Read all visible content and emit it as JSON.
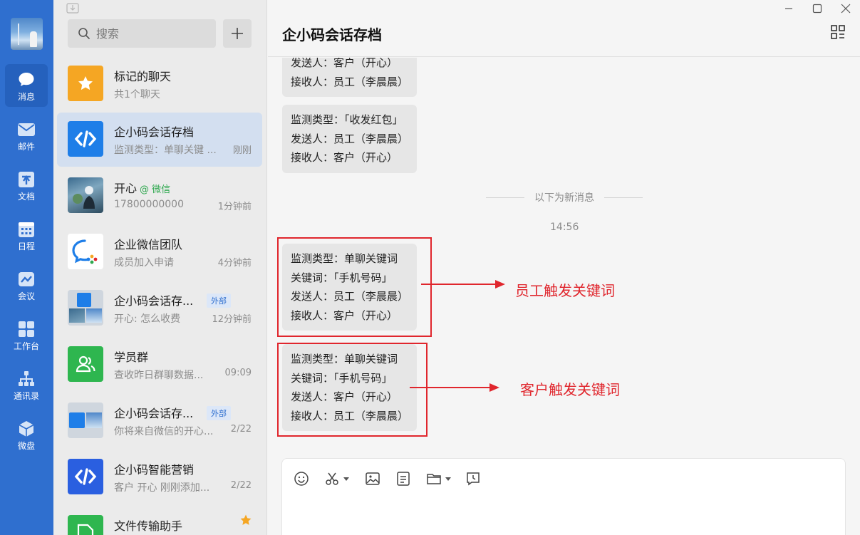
{
  "nav": {
    "items": [
      {
        "label": "消息",
        "icon": "chat-bubble-icon"
      },
      {
        "label": "邮件",
        "icon": "mail-icon"
      },
      {
        "label": "文档",
        "icon": "document-icon"
      },
      {
        "label": "日程",
        "icon": "calendar-icon"
      },
      {
        "label": "会议",
        "icon": "meeting-icon"
      },
      {
        "label": "工作台",
        "icon": "workbench-icon"
      },
      {
        "label": "通讯录",
        "icon": "contacts-icon"
      },
      {
        "label": "微盘",
        "icon": "cloud-drive-icon"
      }
    ]
  },
  "search": {
    "placeholder": "搜索"
  },
  "conversations": [
    {
      "name": "标记的聊天",
      "preview": "共1个聊天",
      "time": ""
    },
    {
      "name": "企小码会话存档",
      "preview": "监测类型：单聊关键 ...",
      "time": "刚刚"
    },
    {
      "name": "开心",
      "tag": "@ 微信",
      "preview": "17800000000",
      "time": "1分钟前"
    },
    {
      "name": "企业微信团队",
      "preview": "成员加入申请",
      "time": "4分钟前"
    },
    {
      "name": "企小码会话存...",
      "tag": "外部",
      "preview": "开心: 怎么收费",
      "time": "12分钟前"
    },
    {
      "name": "学员群",
      "preview": "查收昨日群聊数据...",
      "time": "09:09"
    },
    {
      "name": "企小码会话存...",
      "tag": "外部",
      "preview": "你将来自微信的开心...",
      "time": "2/22"
    },
    {
      "name": "企小码智能营销",
      "preview": "客户 开心 刚刚添加...",
      "time": "2/22"
    },
    {
      "name": "文件传输助手",
      "preview": "",
      "time": ""
    }
  ],
  "chat": {
    "title": "企小码会话存档",
    "messages": [
      {
        "lines": [
          "发送人：客户（开心）",
          "接收人：员工（李晨晨）"
        ]
      },
      {
        "lines": [
          "监测类型：「收发红包」",
          "发送人：员工（李晨晨）",
          "接收人：客户（开心）"
        ]
      },
      {
        "lines": [
          "监测类型：单聊关键词",
          "关键词：「手机号码」",
          "发送人：员工（李晨晨）",
          "接收人：客户（开心）"
        ]
      },
      {
        "lines": [
          "监测类型：单聊关键词",
          "关键词：「手机号码」",
          "发送人：客户（开心）",
          "接收人：员工（李晨晨）"
        ]
      }
    ],
    "divider": "以下为新消息",
    "timestamp": "14:56",
    "annotations": [
      "员工触发关键词",
      "客户触发关键词"
    ]
  },
  "colors": {
    "nav_bg": "#2f6fcf",
    "accent_red": "#e0262d",
    "selected_bg": "#d3dff0"
  }
}
